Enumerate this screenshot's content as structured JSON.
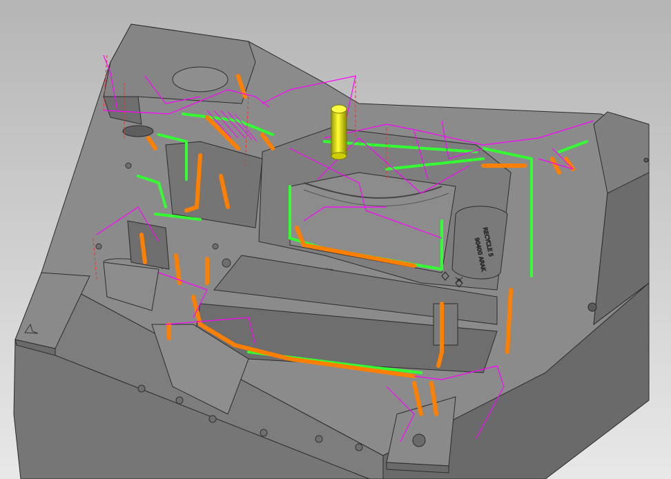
{
  "viewport": {
    "background_top": "#b9b9b9",
    "background_bottom": "#e6e6e6"
  },
  "colors": {
    "mold_top": "#8d8d8d",
    "mold_side": "#6f6f6f",
    "mold_dark": "#5a5a5a",
    "edge": "#2b2b2b",
    "toolpath_orange": "#ff7f00",
    "toolpath_green": "#33ff33",
    "toolpath_magenta": "#ff00ff",
    "toolpath_red": "#ff2a2a",
    "tool_yellow": "#e6e600"
  },
  "engraving": {
    "text_1": "MADE IN USA",
    "text_2": "90400 ARAK",
    "text_3": "RECYCLE 5"
  },
  "icons": [
    "cutting-tool-icon",
    "datum-marker-icon"
  ]
}
